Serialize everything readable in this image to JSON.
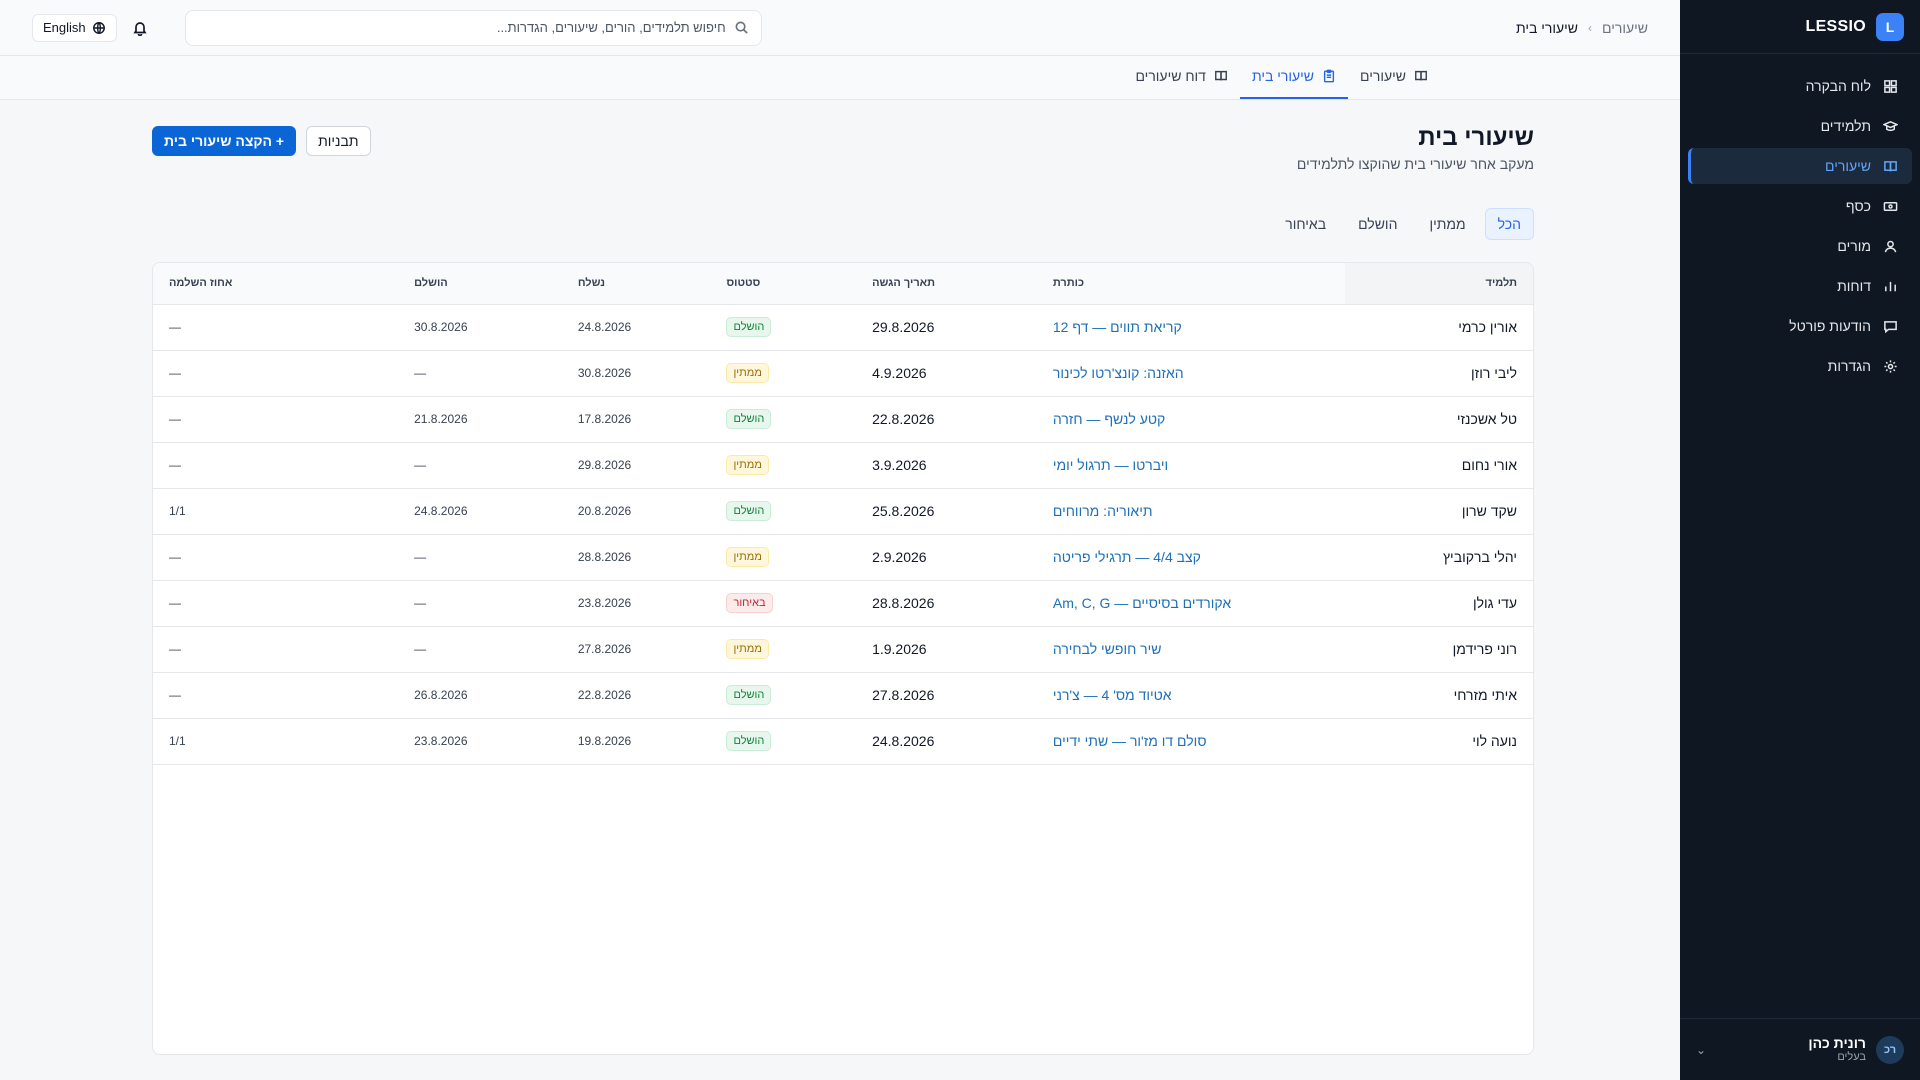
{
  "brand": {
    "logo_letter": "L",
    "name": "LESSIO"
  },
  "sidebar": {
    "items": [
      {
        "label": "לוח הבקרה",
        "icon": "grid-icon"
      },
      {
        "label": "תלמידים",
        "icon": "graduation-cap-icon"
      },
      {
        "label": "שיעורים",
        "icon": "book-icon"
      },
      {
        "label": "כסף",
        "icon": "money-icon"
      },
      {
        "label": "מורים",
        "icon": "user-icon"
      },
      {
        "label": "דוחות",
        "icon": "bar-chart-icon"
      },
      {
        "label": "הודעות פורטל",
        "icon": "message-icon"
      },
      {
        "label": "הגדרות",
        "icon": "gear-icon"
      }
    ],
    "active_index": 2,
    "user": {
      "initials": "רכ",
      "name": "רונית כהן",
      "role": "בעלים"
    }
  },
  "topbar": {
    "breadcrumb_root": "שיעורים",
    "breadcrumb_current": "שיעורי בית",
    "search_placeholder": "חיפוש תלמידים, הורים, שיעורים, הגדרות...",
    "language": "English"
  },
  "subtabs": [
    {
      "label": "שיעורים",
      "active": false
    },
    {
      "label": "שיעורי בית",
      "active": true
    },
    {
      "label": "דוח שיעורים",
      "active": false
    }
  ],
  "page": {
    "title": "שיעורי בית",
    "subtitle": "מעקב אחר שיעורי בית שהוקצו לתלמידים",
    "assign_button": "+ הקצה שיעורי בית",
    "templates_button": "תבניות"
  },
  "filters": [
    "הכל",
    "ממתין",
    "הושלם",
    "באיחור"
  ],
  "active_filter": 0,
  "table": {
    "headers": {
      "student": "תלמיד",
      "title": "כותרת",
      "due": "תאריך הגשה",
      "status": "סטטוס",
      "sent": "נשלח",
      "done": "הושלם",
      "pct": "אחוז השלמה"
    },
    "rows": [
      {
        "student": "אורין כרמי",
        "title": "קריאת תווים — דף 12",
        "due": "29.8.2026",
        "status": "הושלם",
        "status_color": "green",
        "sent": "24.8.2026",
        "done": "30.8.2026",
        "pct": "—"
      },
      {
        "student": "ליבי רוזן",
        "title": "האזנה: קונצ'רטו לכינור",
        "due": "4.9.2026",
        "status": "ממתין",
        "status_color": "yellow",
        "sent": "30.8.2026",
        "done": "—",
        "pct": "—"
      },
      {
        "student": "טל אשכנזי",
        "title": "קטע לנשף — חזרה",
        "due": "22.8.2026",
        "status": "הושלם",
        "status_color": "green",
        "sent": "17.8.2026",
        "done": "21.8.2026",
        "pct": "—"
      },
      {
        "student": "אורי נחום",
        "title": "ויברטו — תרגול יומי",
        "due": "3.9.2026",
        "status": "ממתין",
        "status_color": "yellow",
        "sent": "29.8.2026",
        "done": "—",
        "pct": "—"
      },
      {
        "student": "שקד שרון",
        "title": "תיאוריה: מרווחים",
        "due": "25.8.2026",
        "status": "הושלם",
        "status_color": "green",
        "sent": "20.8.2026",
        "done": "24.8.2026",
        "pct": "1/1"
      },
      {
        "student": "יהלי ברקוביץ",
        "title": "קצב 4/4 — תרגילי פריטה",
        "due": "2.9.2026",
        "status": "ממתין",
        "status_color": "yellow",
        "sent": "28.8.2026",
        "done": "—",
        "pct": "—"
      },
      {
        "student": "עדי גולן",
        "title": "אקורדים בסיסיים — Am, C, G",
        "due": "28.8.2026",
        "status": "באיחור",
        "status_color": "red",
        "sent": "23.8.2026",
        "done": "—",
        "pct": "—"
      },
      {
        "student": "רוני פרידמן",
        "title": "שיר חופשי לבחירה",
        "due": "1.9.2026",
        "status": "ממתין",
        "status_color": "yellow",
        "sent": "27.8.2026",
        "done": "—",
        "pct": "—"
      },
      {
        "student": "איתי מזרחי",
        "title": "אטיוד מס' 4 — צ'רני",
        "due": "27.8.2026",
        "status": "הושלם",
        "status_color": "green",
        "sent": "22.8.2026",
        "done": "26.8.2026",
        "pct": "—"
      },
      {
        "student": "נועה לוי",
        "title": "סולם דו מז'ור — שתי ידיים",
        "due": "24.8.2026",
        "status": "הושלם",
        "status_color": "green",
        "sent": "19.8.2026",
        "done": "23.8.2026",
        "pct": "1/1"
      }
    ]
  }
}
